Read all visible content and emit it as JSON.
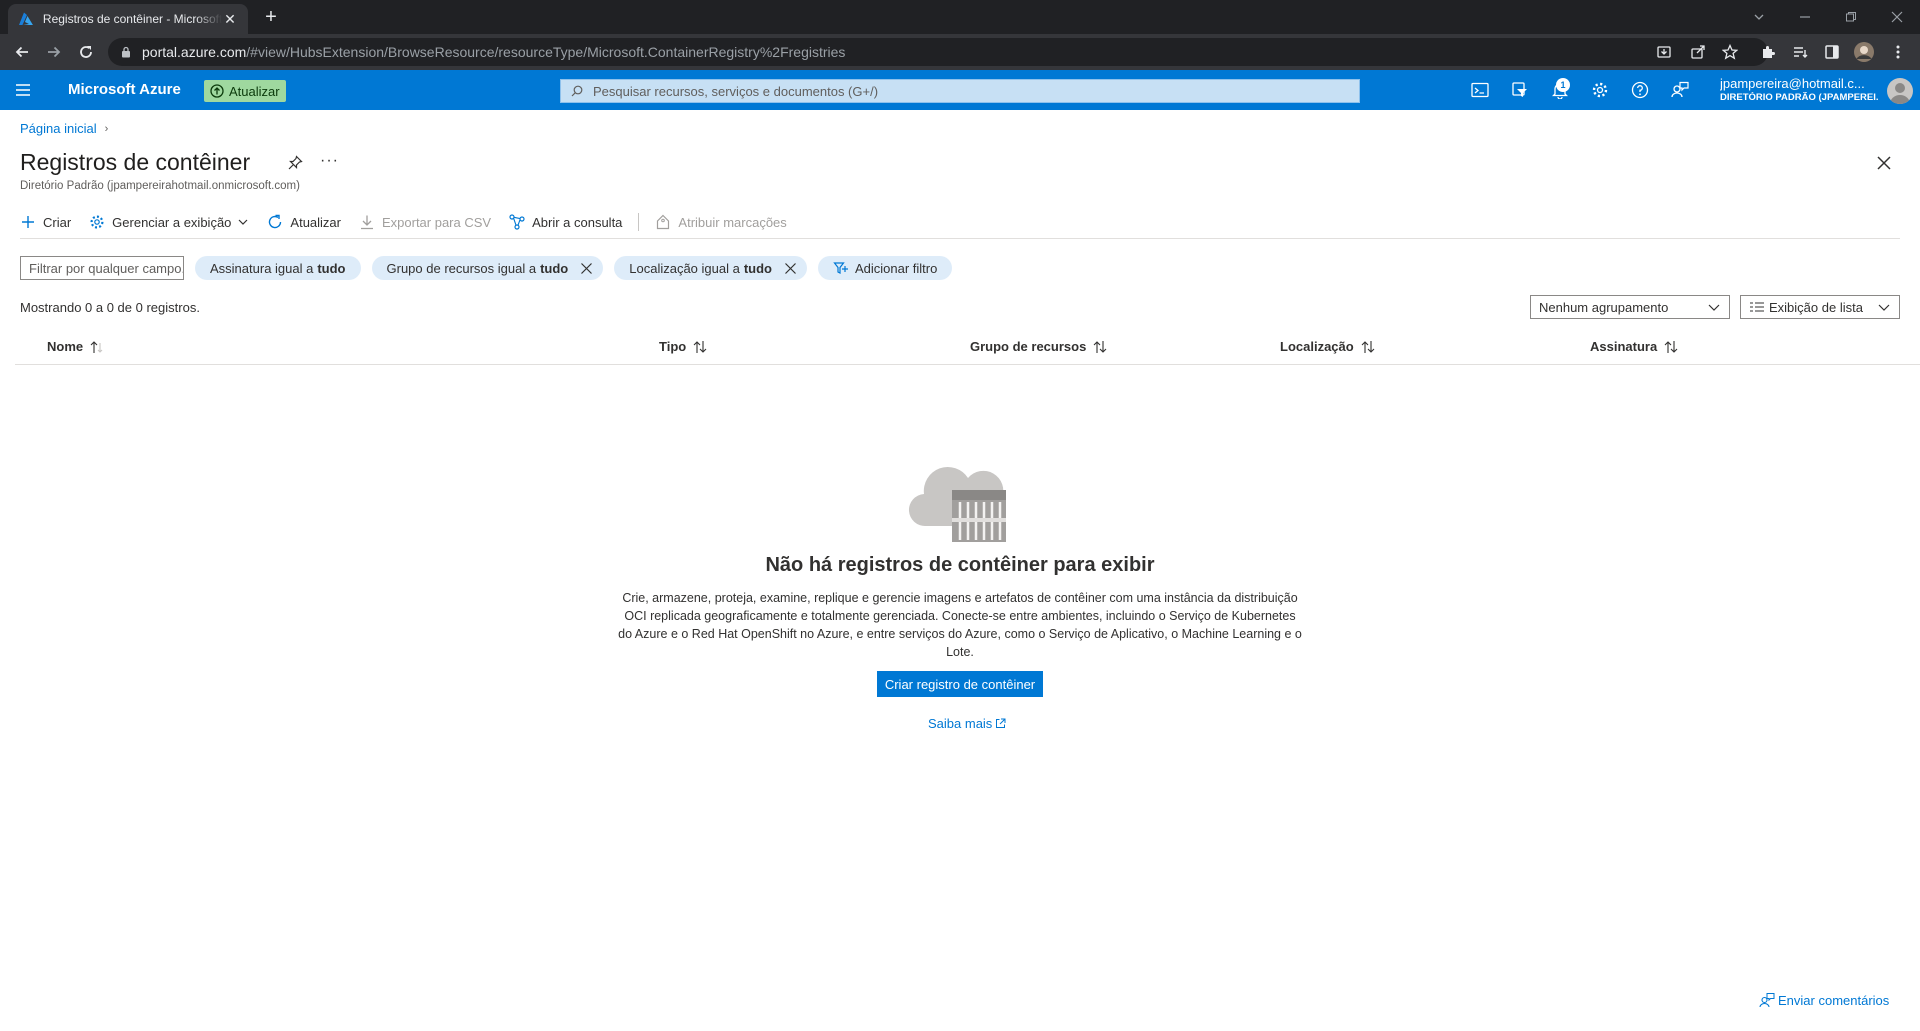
{
  "browser": {
    "tab_title": "Registros de contêiner - Microsoft Azure",
    "tab_close": "✕",
    "new_tab": "+",
    "url_host": "portal.azure.com",
    "url_path": "/#view/HubsExtension/BrowseResource/resourceType/Microsoft.ContainerRegistry%2Fregistries"
  },
  "header": {
    "brand": "Microsoft Azure",
    "upgrade_label": "Atualizar",
    "search_placeholder": "Pesquisar recursos, serviços e documentos (G+/)",
    "notification_count": "1",
    "account_email": "jpampereira@hotmail.c...",
    "account_directory": "DIRETÓRIO PADRÃO (JPAMPEREI..."
  },
  "breadcrumb": {
    "home": "Página inicial",
    "separator": "›"
  },
  "page": {
    "title": "Registros de contêiner",
    "more": "···",
    "subtitle": "Diretório Padrão (jpampereirahotmail.onmicrosoft.com)"
  },
  "commands": {
    "create": "Criar",
    "manage_view": "Gerenciar a exibição",
    "refresh": "Atualizar",
    "export_csv": "Exportar para CSV",
    "open_query": "Abrir a consulta",
    "assign_tags": "Atribuir marcações"
  },
  "filters": {
    "search_placeholder": "Filtrar por qualquer campo...",
    "pills": [
      {
        "label": "Assinatura igual a",
        "value": "tudo"
      },
      {
        "label": "Grupo de recursos igual a",
        "value": "tudo"
      },
      {
        "label": "Localização igual a",
        "value": "tudo"
      }
    ],
    "add_filter": "Adicionar filtro"
  },
  "results": {
    "summary": "Mostrando 0 a 0 de 0 registros.",
    "grouping": "Nenhum agrupamento",
    "view_mode": "Exibição de lista"
  },
  "table": {
    "columns": [
      "Nome",
      "Tipo",
      "Grupo de recursos",
      "Localização",
      "Assinatura"
    ]
  },
  "empty_state": {
    "title": "Não há registros de contêiner para exibir",
    "description": "Crie, armazene, proteja, examine, replique e gerencie imagens e artefatos de contêiner com uma instância da distribuição OCI replicada geograficamente e totalmente gerenciada. Conecte-se entre ambientes, incluindo o Serviço de Kubernetes do Azure e o Red Hat OpenShift no Azure, e entre serviços do Azure, como o Serviço de Aplicativo, o Machine Learning e o Lote.",
    "create_button": "Criar registro de contêiner",
    "learn_more": "Saiba mais"
  },
  "footer": {
    "feedback": "Enviar comentários"
  },
  "colors": {
    "azure_blue": "#0078d4",
    "upgrade_green": "#9fd89f",
    "pill_bg": "#deecf9"
  }
}
